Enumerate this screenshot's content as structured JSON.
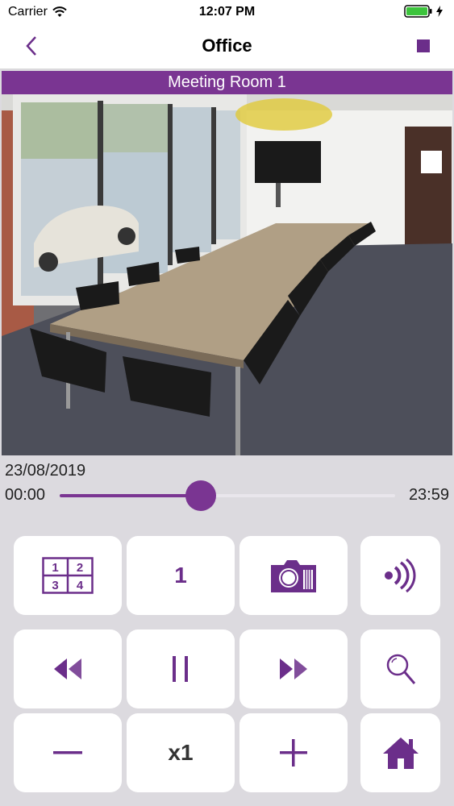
{
  "status": {
    "carrier": "Carrier",
    "time": "12:07 PM"
  },
  "nav": {
    "title": "Office"
  },
  "camera": {
    "name": "Meeting Room 1"
  },
  "playback": {
    "date": "23/08/2019",
    "start": "00:00",
    "end": "23:59",
    "position": 0.42
  },
  "grid_icon": {
    "d1": "1",
    "d2": "2",
    "d3": "3",
    "d4": "4"
  },
  "controls": {
    "camera_number": "1",
    "speed": "x1"
  },
  "colors": {
    "accent": "#7a3592",
    "background": "#dcdadf"
  }
}
